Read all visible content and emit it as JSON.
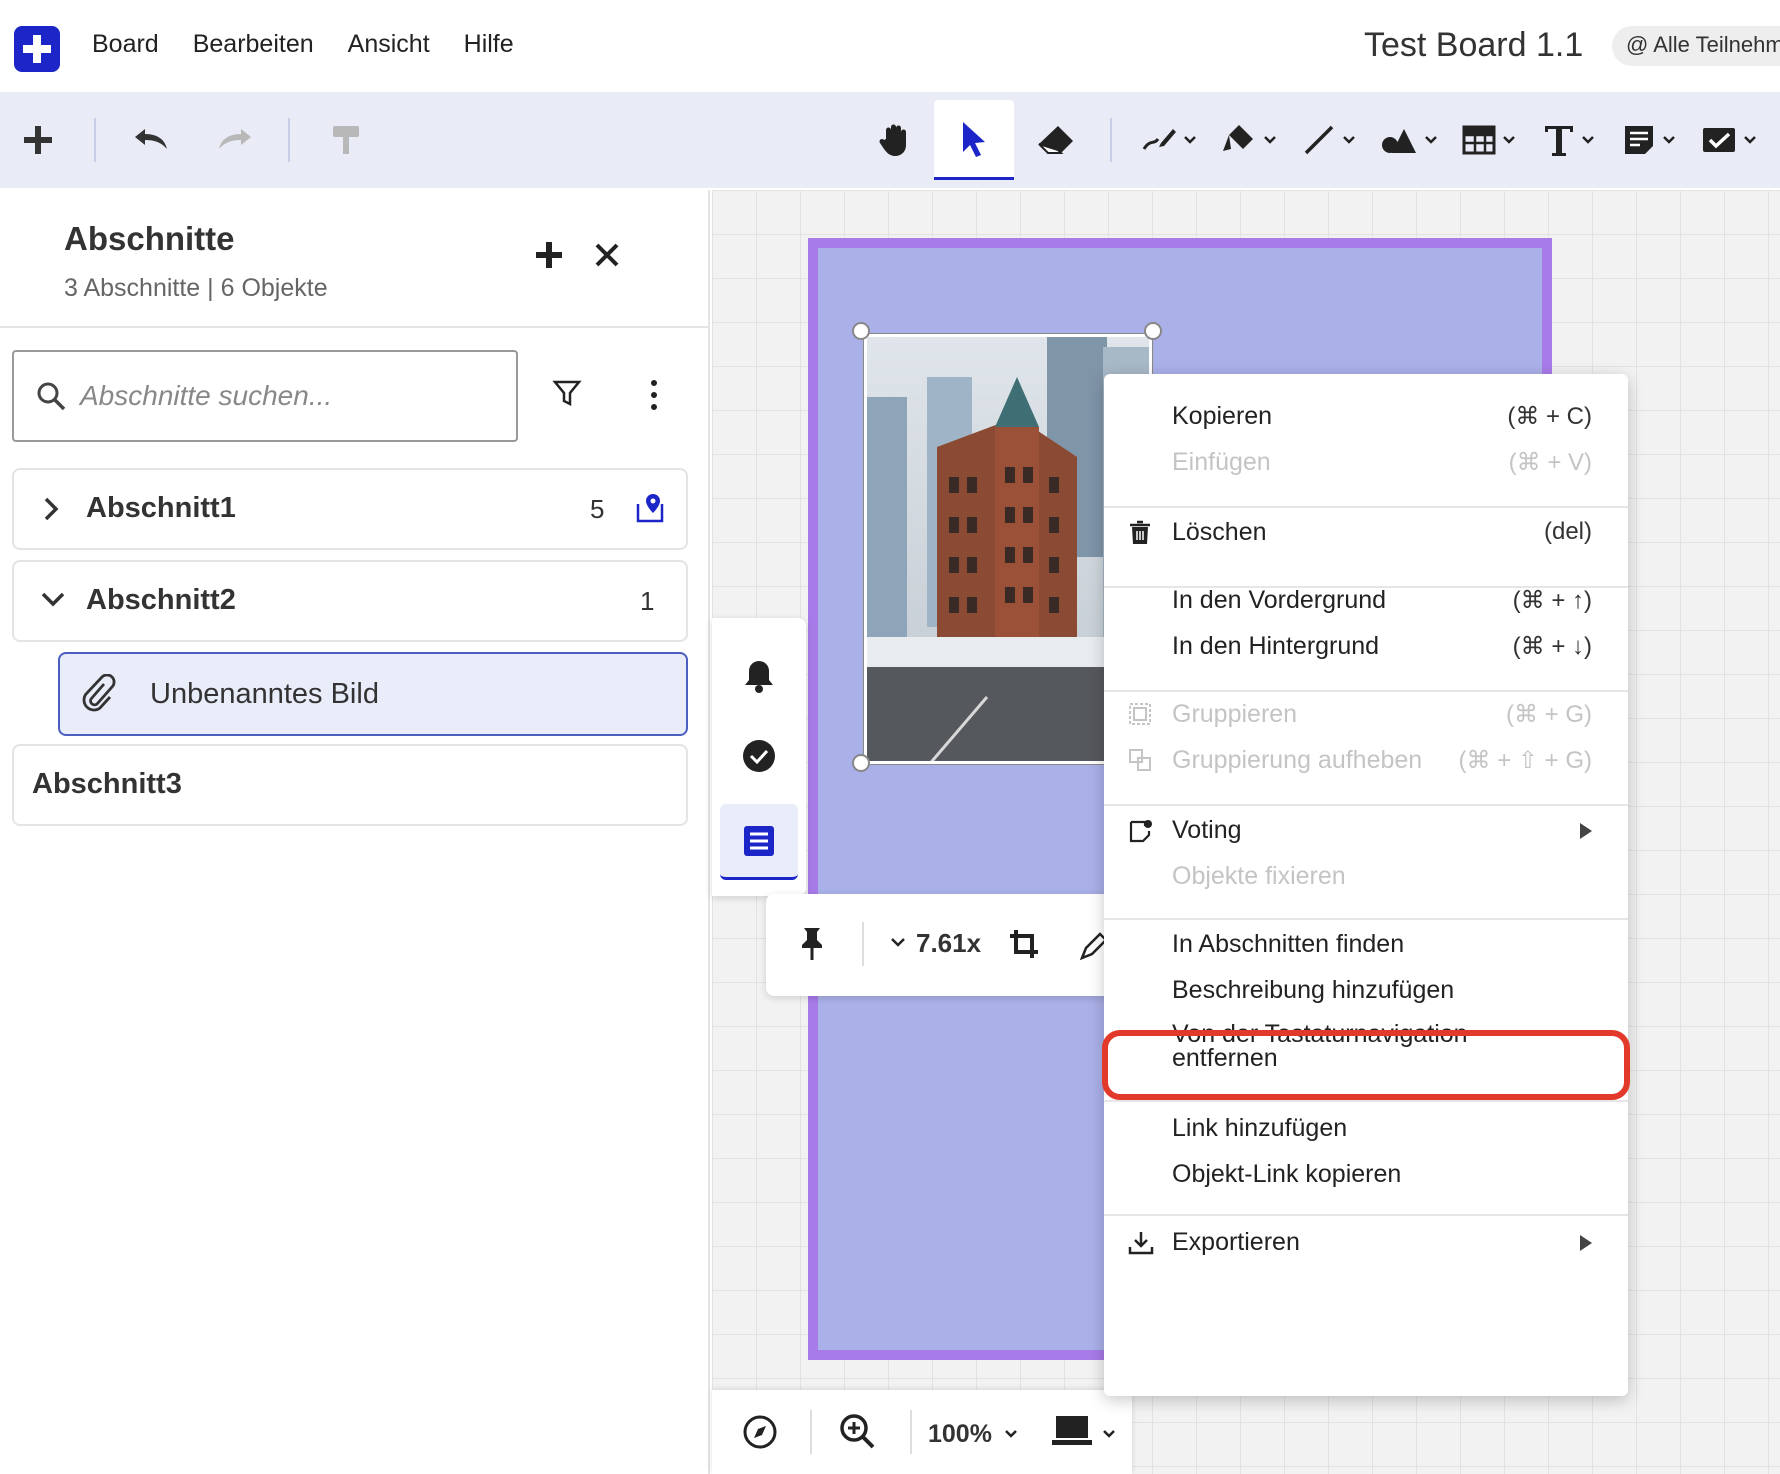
{
  "menubar": {
    "items": [
      "Board",
      "Bearbeiten",
      "Ansicht",
      "Hilfe"
    ],
    "board_title": "Test Board 1.1",
    "participants": "@ Alle Teilnehm"
  },
  "colors": {
    "brand": "#1b25c8",
    "frame_fill": "#aab0e8",
    "frame_border": "#a77be8",
    "highlight": "#e3392a"
  },
  "panel": {
    "title": "Abschnitte",
    "subtitle": "3 Abschnitte | 6 Objekte",
    "search_placeholder": "Abschnitte suchen...",
    "sections": [
      {
        "name": "Abschnitt1",
        "count": "5",
        "expanded": false
      },
      {
        "name": "Abschnitt2",
        "count": "1",
        "expanded": true
      },
      {
        "name": "Abschnitt3",
        "count": "",
        "expanded": false
      }
    ],
    "item": {
      "name": "Unbenanntes Bild"
    }
  },
  "object_toolbar": {
    "scale": "7.61x"
  },
  "bottom": {
    "zoom": "100%"
  },
  "context_menu": {
    "copy": {
      "label": "Kopieren",
      "shortcut": "(⌘ + C)"
    },
    "paste": {
      "label": "Einfügen",
      "shortcut": "(⌘ + V)"
    },
    "delete": {
      "label": "Löschen",
      "shortcut": "(del)"
    },
    "front": {
      "label": "In den Vordergrund",
      "shortcut": "(⌘ + ↑)"
    },
    "back": {
      "label": "In den Hintergrund",
      "shortcut": "(⌘ + ↓)"
    },
    "group": {
      "label": "Gruppieren",
      "shortcut": "(⌘ + G)"
    },
    "ungroup": {
      "label": "Gruppierung aufheben",
      "shortcut": "(⌘ + ⇧ + G)"
    },
    "voting": {
      "label": "Voting"
    },
    "pin": {
      "label": "Objekte fixieren"
    },
    "find": {
      "label": "In Abschnitten finden"
    },
    "description": {
      "label": "Beschreibung hinzufügen"
    },
    "keyboard_nav": {
      "label_line1": "Von der Tastaturnavigation",
      "label_line2": "entfernen"
    },
    "link_add": {
      "label": "Link hinzufügen"
    },
    "link_copy": {
      "label": "Objekt-Link kopieren"
    },
    "export": {
      "label": "Exportieren"
    }
  }
}
